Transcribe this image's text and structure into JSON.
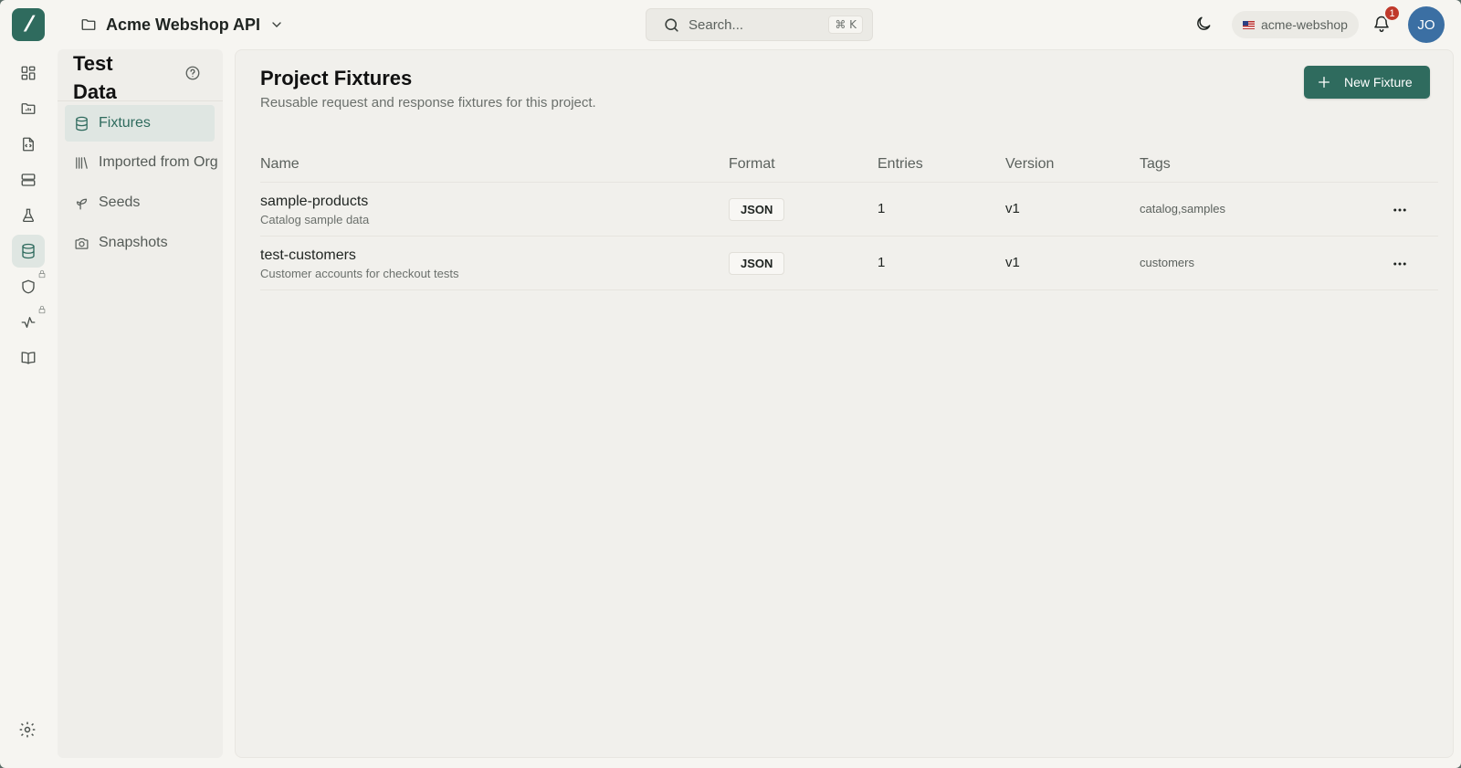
{
  "app": {
    "logo_glyph": "/"
  },
  "header": {
    "project_name": "Acme Webshop API",
    "search_placeholder": "Search...",
    "search_shortcut": "⌘ K",
    "workspace": "acme-webshop",
    "notification_count": "1",
    "avatar_initials": "JO"
  },
  "rail": {
    "items": [
      {
        "icon": "dashboard-icon"
      },
      {
        "icon": "folder-chart-icon"
      },
      {
        "icon": "code-file-icon"
      },
      {
        "icon": "server-icon"
      },
      {
        "icon": "flask-icon"
      },
      {
        "icon": "database-icon",
        "active": true
      },
      {
        "icon": "shield-icon",
        "locked": true
      },
      {
        "icon": "activity-icon",
        "locked": true
      },
      {
        "icon": "book-open-icon"
      }
    ],
    "bottom_icon": "settings-icon"
  },
  "subnav": {
    "title_line1": "Test",
    "title_line2": "Data",
    "items": [
      {
        "label": "Fixtures",
        "icon": "database-icon",
        "active": true
      },
      {
        "label": "Imported from Org",
        "icon": "library-icon"
      },
      {
        "label": "Seeds",
        "icon": "sprout-icon"
      },
      {
        "label": "Snapshots",
        "icon": "camera-icon"
      }
    ]
  },
  "main": {
    "title": "Project Fixtures",
    "subtitle": "Reusable request and response fixtures for this project.",
    "new_button_label": "New Fixture",
    "columns": [
      "Name",
      "Format",
      "Entries",
      "Version",
      "Tags"
    ],
    "rows": [
      {
        "name": "sample-products",
        "description": "Catalog sample data",
        "format": "JSON",
        "entries": "1",
        "version": "v1",
        "tags": "catalog,samples"
      },
      {
        "name": "test-customers",
        "description": "Customer accounts for checkout tests",
        "format": "JSON",
        "entries": "1",
        "version": "v1",
        "tags": "customers"
      }
    ]
  },
  "colors": {
    "accent": "#2f6b5e",
    "badge_red": "#c0392b",
    "avatar_blue": "#3b6fa3"
  }
}
